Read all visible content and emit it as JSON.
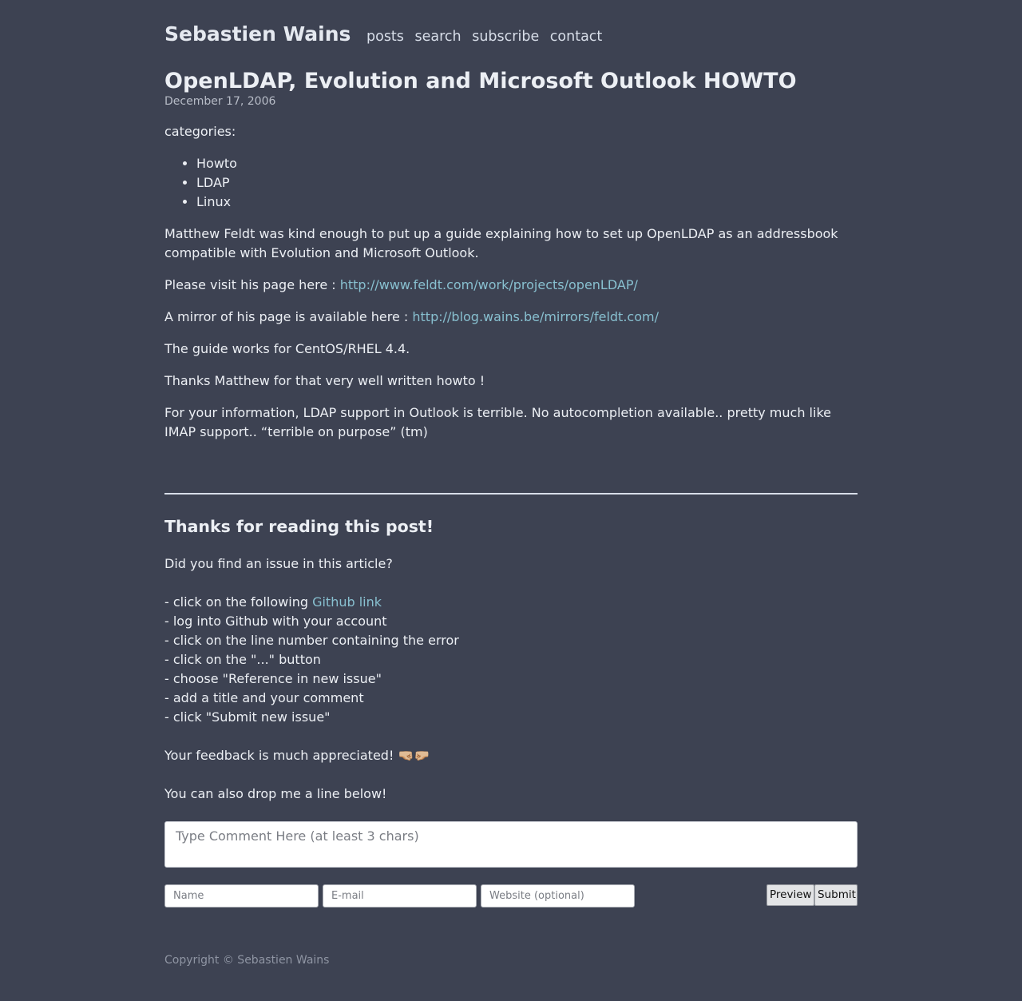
{
  "site": {
    "title": "Sebastien Wains",
    "nav": [
      "posts",
      "search",
      "subscribe",
      "contact"
    ]
  },
  "post": {
    "title": "OpenLDAP, Evolution and Microsoft Outlook HOWTO",
    "date": "December 17, 2006",
    "categories_label": "categories:",
    "categories": [
      "Howto",
      "LDAP",
      "Linux"
    ],
    "intro": "Matthew Feldt was kind enough to put up a guide explaining how to set up OpenLDAP as an addressbook compatible with Evolution and Microsoft Outlook.",
    "visit_prefix": "Please visit his page here : ",
    "visit_link": "http://www.feldt.com/work/projects/openLDAP/",
    "mirror_prefix": "A mirror of his page is available here : ",
    "mirror_link": "http://blog.wains.be/mirrors/feldt.com/",
    "works_for": "The guide works for CentOS/RHEL 4.4.",
    "thanks_matthew": "Thanks Matthew for that very well written howto !",
    "outlook_note": "For your information, LDAP support in Outlook is terrible. No autocompletion available.. pretty much like IMAP support.. “terrible on purpose” (tm)"
  },
  "feedback": {
    "heading": "Thanks for reading this post!",
    "question": "Did you find an issue in this article?",
    "step1_prefix": "- click on the following ",
    "step1_link": "Github link",
    "steps": [
      "- log into Github with your account",
      "- click on the line number containing the error",
      "- click on the \"...\" button",
      "- choose \"Reference in new issue\"",
      "- add a title and your comment",
      "- click \"Submit new issue\""
    ],
    "appreciated": "Your feedback is much appreciated! 🤜🏼🤛🏼",
    "drop_line": "You can also drop me a line below!"
  },
  "comment_form": {
    "comment_placeholder": "Type Comment Here (at least 3 chars)",
    "name_placeholder": "Name",
    "email_placeholder": "E-mail",
    "website_placeholder": "Website (optional)",
    "preview_label": "Preview",
    "submit_label": "Submit"
  },
  "footer": {
    "copyright": "Copyright © Sebastien Wains"
  },
  "colors": {
    "background": "#3d4252",
    "text": "#eceff4",
    "link": "#88c0d0",
    "muted": "#8f95a3"
  }
}
